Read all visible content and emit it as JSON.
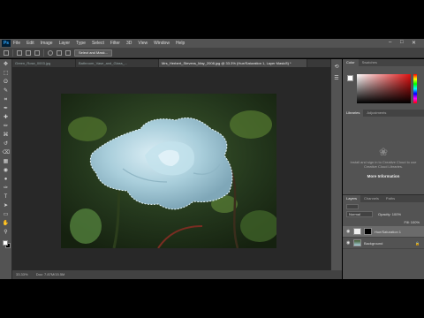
{
  "app": {
    "logo": "Ps",
    "menu": [
      "File",
      "Edit",
      "Image",
      "Layer",
      "Type",
      "Select",
      "Filter",
      "3D",
      "View",
      "Window",
      "Help"
    ],
    "window_controls": [
      "–",
      "□",
      "✕"
    ]
  },
  "options_bar": {
    "select_and_mask": "Select and Mask..."
  },
  "tabs": [
    {
      "label": "Green_Rose_0003.jpg",
      "active": false
    },
    {
      "label": "Bathroom_Vase_and_Glass_...",
      "active": false
    },
    {
      "label": "Mrs_Herbert_Stevens_May_2008.jpg @ 33.3% (Hue/Saturation 1, Layer Mask/8) *",
      "active": true
    }
  ],
  "toolbar": {
    "icons": [
      "move-icon",
      "marquee-icon",
      "lasso-icon",
      "quick-select-icon",
      "crop-icon",
      "eyedropper-icon",
      "healing-icon",
      "brush-icon",
      "stamp-icon",
      "history-brush-icon",
      "eraser-icon",
      "gradient-icon",
      "blur-icon",
      "dodge-icon",
      "pen-icon",
      "type-icon",
      "path-select-icon",
      "shape-icon",
      "hand-icon",
      "zoom-icon"
    ],
    "glyphs": [
      "✥",
      "⬚",
      "ʘ",
      "✎",
      "⌗",
      "✒",
      "✚",
      "✏",
      "⌘",
      "↺",
      "⌫",
      "▦",
      "◉",
      "●",
      "✑",
      "T",
      "➤",
      "▭",
      "✋",
      "⚲"
    ]
  },
  "status": {
    "zoom": "33.33%",
    "doc": "Doc: 7.87M/15.5M"
  },
  "right_panels": {
    "color_tabs": [
      "Color",
      "Swatches"
    ],
    "library_tabs": [
      "Libraries",
      "Adjustments"
    ],
    "library_message": "Install and sign in to Creative Cloud to use Creative Cloud Libraries.",
    "library_link": "More Information",
    "layers_tabs": [
      "Layers",
      "Channels",
      "Paths"
    ],
    "blend_mode": "Normal",
    "opacity": "Opacity: 100%",
    "fill": "Fill: 100%",
    "layers": [
      {
        "name": "Hue/Saturation 1",
        "active": true
      },
      {
        "name": "Background",
        "active": false
      }
    ]
  },
  "colors": {
    "fg": "#ffffff",
    "bg": "#000000",
    "rose": "#a9cedb"
  }
}
